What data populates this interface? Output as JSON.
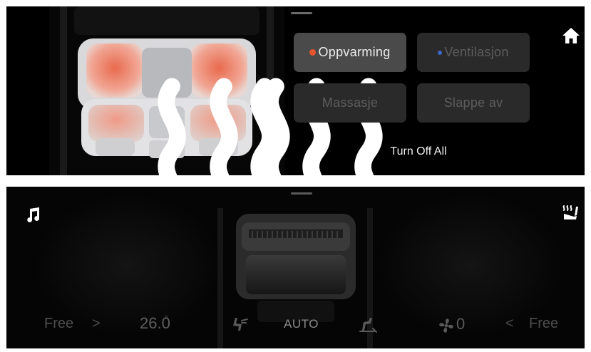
{
  "top_panel": {
    "modes": [
      {
        "label": "Oppvarming",
        "active": true
      },
      {
        "label": "Ventilasjon",
        "active": false
      },
      {
        "label": "Massasje",
        "active": false
      },
      {
        "label": "Slappe av",
        "active": false
      }
    ],
    "turn_off_label": "Turn Off All",
    "home_icon": "home-icon",
    "seat_heat_icons": [
      "heat-waves-icon",
      "heat-waves-icon"
    ],
    "colors": {
      "heat": "#e8552c",
      "ventilation": "#3c68c6"
    }
  },
  "bottom_panel": {
    "music_icon": "music-note-icon",
    "seat_heat_icon": "seat-heat-icon",
    "left_mode": "Free",
    "left_chevron": ">",
    "temperature": "26.0",
    "temperature_degree": "°",
    "auto_label": "AUTO",
    "fan_level": "0",
    "right_chevron": "<",
    "right_mode": "Free"
  }
}
